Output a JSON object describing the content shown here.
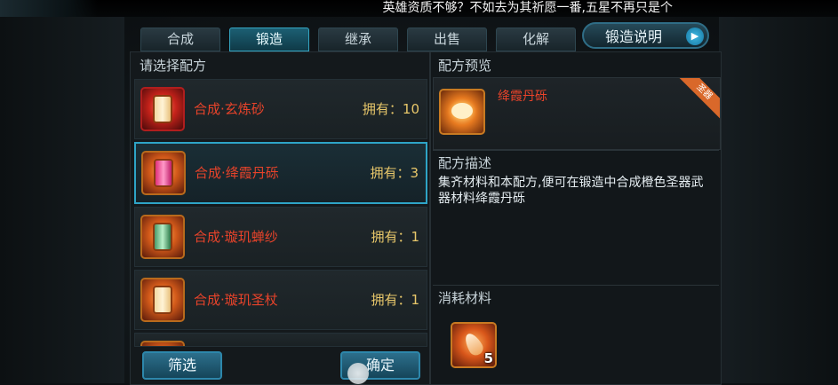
{
  "marquee": "英雄资质不够？不如去为其祈愿一番,五星不再只是个",
  "tabs": [
    {
      "label": "合成",
      "active": false
    },
    {
      "label": "锻造",
      "active": true
    },
    {
      "label": "继承",
      "active": false
    },
    {
      "label": "出售",
      "active": false
    },
    {
      "label": "化解",
      "active": false
    }
  ],
  "help_button": {
    "label": "锻造说明",
    "arrow": "▶"
  },
  "left_panel": {
    "title": "请选择配方",
    "items": [
      {
        "name": "合成·玄炼砂",
        "count": "拥有：10",
        "selected": false,
        "icon": "red-scroll-icon"
      },
      {
        "name": "合成·绛霞丹砾",
        "count": "拥有：3",
        "selected": true,
        "icon": "pink-scroll-icon"
      },
      {
        "name": "合成·璇玑蝉纱",
        "count": "拥有：1",
        "selected": false,
        "icon": "green-scroll-icon"
      },
      {
        "name": "合成·璇玑圣杖",
        "count": "拥有：1",
        "selected": false,
        "icon": "orange-scroll-icon"
      }
    ]
  },
  "buttons": {
    "filter": "筛选",
    "confirm": "确定"
  },
  "right_panel": {
    "preview_title": "配方预览",
    "preview_name": "绛霞丹砾",
    "ribbon": "圣器",
    "desc_title": "配方描述",
    "description": "集齐材料和本配方,便可在锻造中合成橙色圣器武器材料绛霞丹砾",
    "materials_title": "消耗材料",
    "material_qty": "5"
  },
  "colors": {
    "accent": "#2ea4c6",
    "item_name": "#e8432a",
    "count": "#e8c76a"
  }
}
